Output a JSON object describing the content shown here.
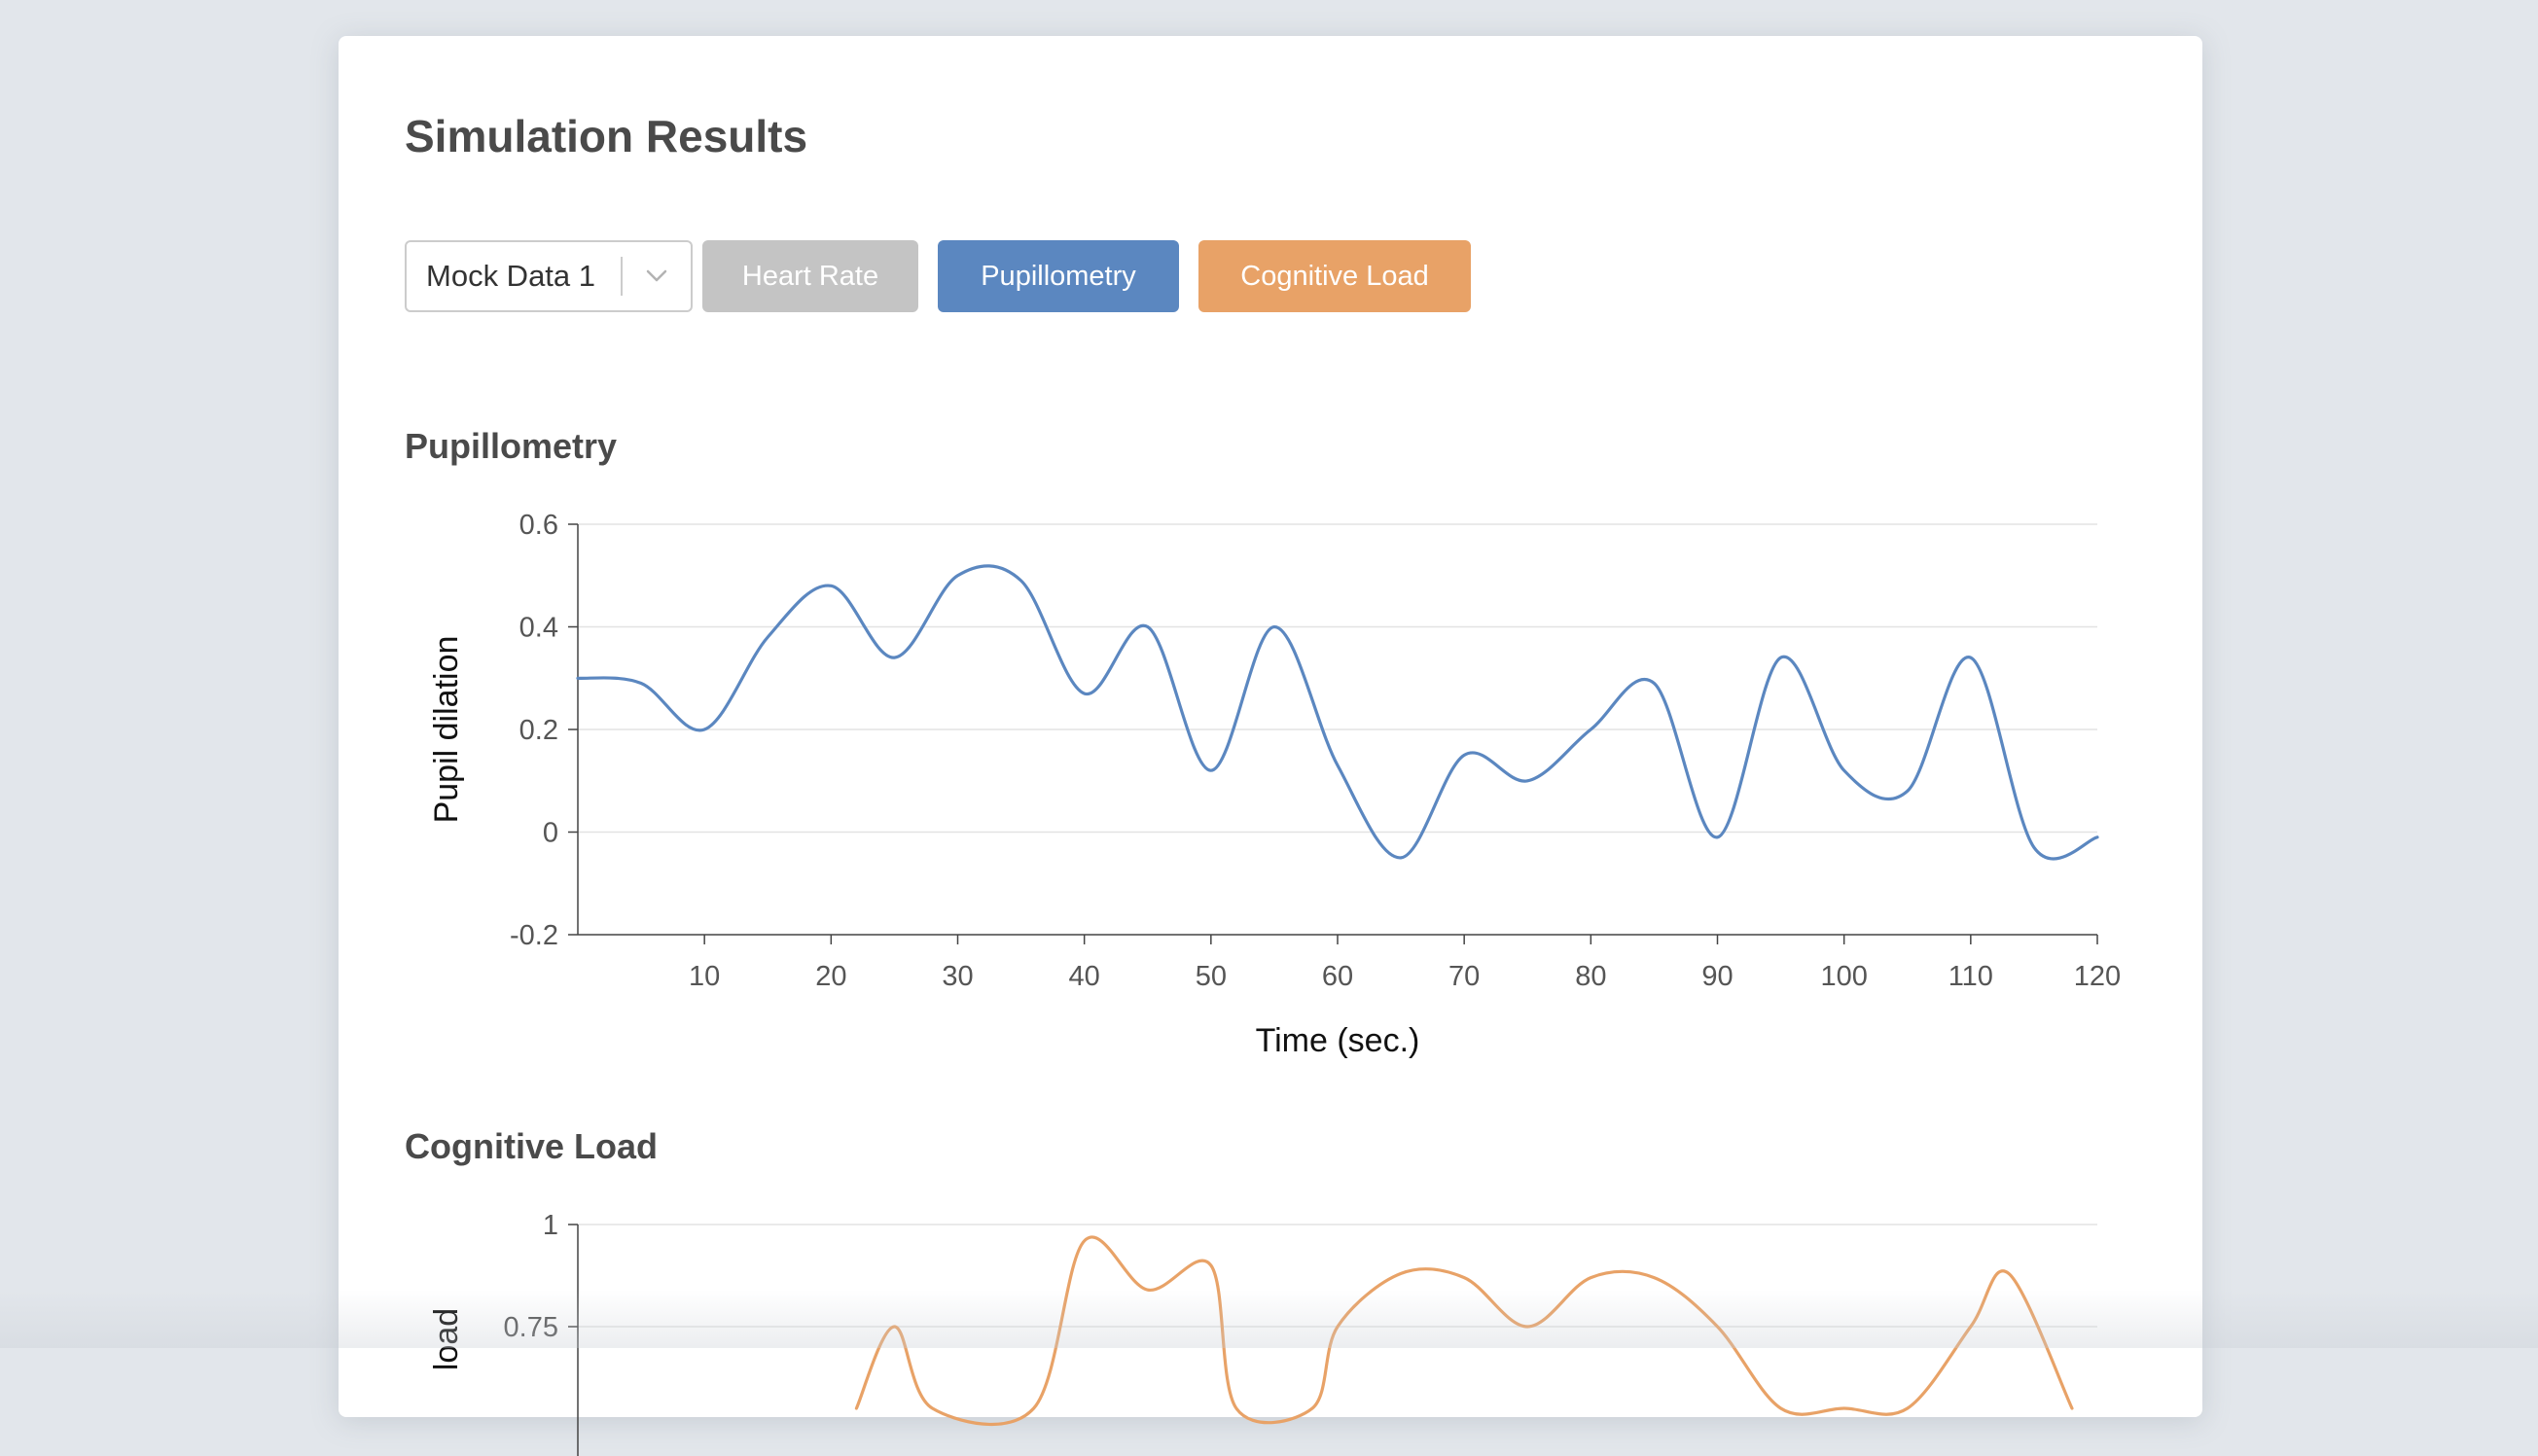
{
  "page": {
    "title": "Simulation Results"
  },
  "controls": {
    "dataset_select": {
      "value": "Mock Data 1",
      "icon": "chevron-down-icon"
    },
    "buttons": [
      {
        "label": "Heart Rate",
        "color": "#c4c4c4"
      },
      {
        "label": "Pupillometry",
        "color": "#5b87c0"
      },
      {
        "label": "Cognitive Load",
        "color": "#e8a267"
      }
    ]
  },
  "sections": {
    "pupillometry": {
      "title": "Pupillometry"
    },
    "cognitive_load": {
      "title": "Cognitive Load"
    }
  },
  "chart_data": [
    {
      "type": "line",
      "xlabel": "Time (sec.)",
      "ylabel": "Pupil dilation",
      "xlim": [
        0,
        120
      ],
      "ylim": [
        -0.2,
        0.6
      ],
      "xticks": [
        10,
        20,
        30,
        40,
        50,
        60,
        70,
        80,
        90,
        100,
        110,
        120
      ],
      "yticks": [
        -0.2,
        0,
        0.2,
        0.4,
        0.6
      ],
      "ytick_labels": [
        "-0.2",
        "0",
        "0.2",
        "0.4",
        "0.6"
      ],
      "grid": true,
      "color": "#5b87c0",
      "series": [
        {
          "x": [
            0,
            5,
            10,
            15,
            20,
            25,
            30,
            35,
            40,
            45,
            50,
            55,
            60,
            65,
            70,
            75,
            80,
            85,
            90,
            95,
            100,
            105,
            110,
            115,
            120
          ],
          "y": [
            0.3,
            0.29,
            0.2,
            0.38,
            0.48,
            0.34,
            0.5,
            0.49,
            0.27,
            0.4,
            0.12,
            0.4,
            0.13,
            -0.05,
            0.15,
            0.1,
            0.2,
            0.29,
            -0.01,
            0.34,
            0.12,
            0.08,
            0.34,
            -0.03,
            -0.01
          ]
        }
      ]
    },
    {
      "type": "line",
      "xlabel": "",
      "ylabel": "load",
      "xlim": [
        0,
        120
      ],
      "ylim": [
        0,
        1
      ],
      "yticks": [
        0.75,
        1
      ],
      "ytick_labels": [
        "0.75",
        "1"
      ],
      "grid": true,
      "color": "#e8a267",
      "series": [
        {
          "x": [
            22,
            25,
            28,
            36,
            40,
            45,
            50,
            52,
            58,
            60,
            65,
            70,
            75,
            80,
            85,
            90,
            95,
            100,
            105,
            110,
            113,
            118
          ],
          "y": [
            0.55,
            0.75,
            0.55,
            0.55,
            0.96,
            0.84,
            0.9,
            0.55,
            0.55,
            0.75,
            0.88,
            0.87,
            0.75,
            0.87,
            0.87,
            0.75,
            0.55,
            0.55,
            0.55,
            0.75,
            0.88,
            0.55
          ]
        }
      ]
    }
  ]
}
